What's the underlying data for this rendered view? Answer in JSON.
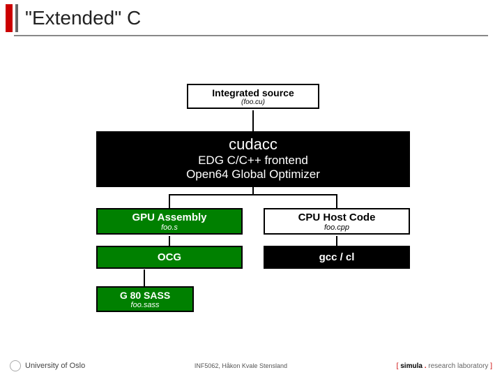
{
  "title": "\"Extended\" C",
  "boxes": {
    "integrated": {
      "main": "Integrated source",
      "sub": "(foo.cu)"
    },
    "cudacc": {
      "main": "cudacc",
      "line1": "EDG C/C++ frontend",
      "line2": "Open64 Global Optimizer"
    },
    "gpu_asm": {
      "main": "GPU  Assembly",
      "sub": "foo.s"
    },
    "cpu_host": {
      "main": "CPU Host Code",
      "sub": "foo.cpp"
    },
    "ocg": {
      "main": "OCG"
    },
    "gcc": {
      "main": "gcc / cl"
    },
    "sass": {
      "main": "G 80 SASS",
      "sub": "foo.sass"
    }
  },
  "footer": {
    "uio": "University of Oslo",
    "course": "INF5062, Håkon Kvale Stensland",
    "lab_pre": "[ ",
    "lab_sim": "simula",
    "lab_dot": " . ",
    "lab_tail": "research laboratory",
    "lab_post": " ]"
  }
}
